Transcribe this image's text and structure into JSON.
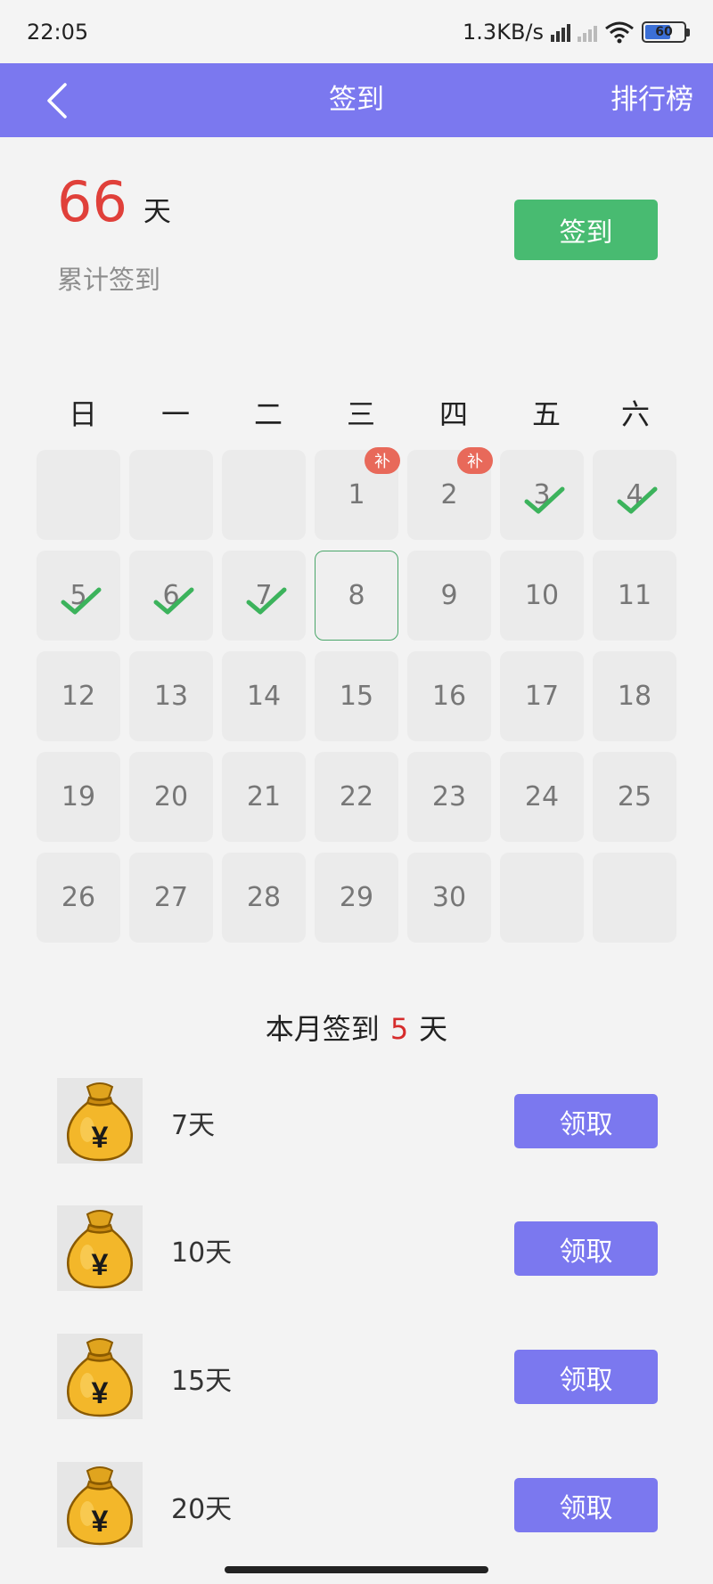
{
  "status_bar": {
    "time": "22:05",
    "network_speed": "1.3KB/s",
    "battery_level": "60",
    "icons": [
      "hd-signal-icon",
      "signal-no-service-icon",
      "wifi-icon",
      "battery-icon"
    ]
  },
  "header": {
    "title": "签到",
    "rank_label": "排行榜",
    "background_color": "#7b78ef"
  },
  "summary": {
    "total_days": "66",
    "unit": "天",
    "label": "累计签到",
    "sign_button_label": "签到",
    "sign_button_color": "#48bb71"
  },
  "calendar": {
    "weekdays": [
      "日",
      "一",
      "二",
      "三",
      "四",
      "五",
      "六"
    ],
    "makeup_badge_label": "补",
    "weeks": [
      [
        {
          "day": "",
          "state": "empty"
        },
        {
          "day": "",
          "state": "empty"
        },
        {
          "day": "",
          "state": "empty"
        },
        {
          "day": "1",
          "state": "makeup"
        },
        {
          "day": "2",
          "state": "makeup"
        },
        {
          "day": "3",
          "state": "checked"
        },
        {
          "day": "4",
          "state": "checked"
        }
      ],
      [
        {
          "day": "5",
          "state": "checked"
        },
        {
          "day": "6",
          "state": "checked"
        },
        {
          "day": "7",
          "state": "checked"
        },
        {
          "day": "8",
          "state": "today"
        },
        {
          "day": "9",
          "state": "normal"
        },
        {
          "day": "10",
          "state": "normal"
        },
        {
          "day": "11",
          "state": "normal"
        }
      ],
      [
        {
          "day": "12",
          "state": "normal"
        },
        {
          "day": "13",
          "state": "normal"
        },
        {
          "day": "14",
          "state": "normal"
        },
        {
          "day": "15",
          "state": "normal"
        },
        {
          "day": "16",
          "state": "normal"
        },
        {
          "day": "17",
          "state": "normal"
        },
        {
          "day": "18",
          "state": "normal"
        }
      ],
      [
        {
          "day": "19",
          "state": "normal"
        },
        {
          "day": "20",
          "state": "normal"
        },
        {
          "day": "21",
          "state": "normal"
        },
        {
          "day": "22",
          "state": "normal"
        },
        {
          "day": "23",
          "state": "normal"
        },
        {
          "day": "24",
          "state": "normal"
        },
        {
          "day": "25",
          "state": "normal"
        }
      ],
      [
        {
          "day": "26",
          "state": "normal"
        },
        {
          "day": "27",
          "state": "normal"
        },
        {
          "day": "28",
          "state": "normal"
        },
        {
          "day": "29",
          "state": "normal"
        },
        {
          "day": "30",
          "state": "normal"
        },
        {
          "day": "",
          "state": "empty"
        },
        {
          "day": "",
          "state": "empty"
        }
      ]
    ],
    "today_border_color": "#4aa66a",
    "check_color": "#3cb35c",
    "badge_color": "#e8695a"
  },
  "month_summary": {
    "prefix": "本月签到",
    "count": "5",
    "suffix": "天"
  },
  "rewards": [
    {
      "label": "7天",
      "button": "领取",
      "icon": "money-bag-icon"
    },
    {
      "label": "10天",
      "button": "领取",
      "icon": "money-bag-icon"
    },
    {
      "label": "15天",
      "button": "领取",
      "icon": "money-bag-icon"
    },
    {
      "label": "20天",
      "button": "领取",
      "icon": "money-bag-icon"
    }
  ]
}
